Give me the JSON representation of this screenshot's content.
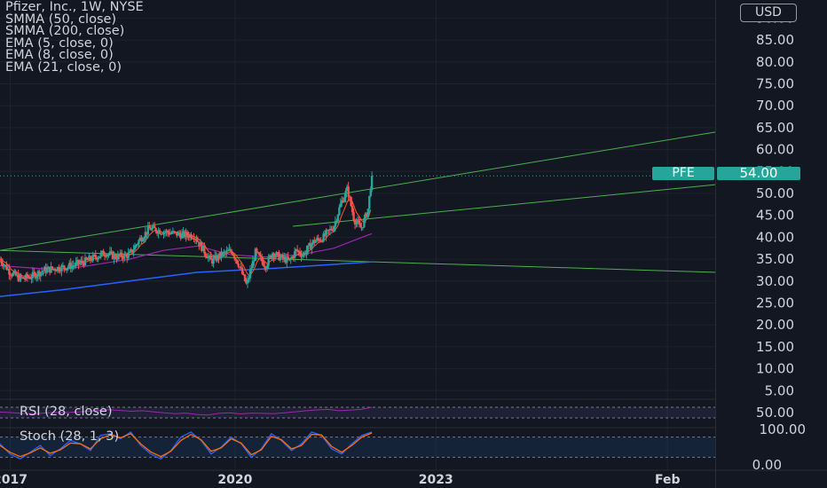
{
  "legend": {
    "title": "Pfizer, Inc., 1W, NYSE",
    "lines": [
      "SMMA (50, close)",
      "SMMA (200, close)",
      "EMA (5, close, 0)",
      "EMA (8, close, 0)",
      "EMA (21, close, 0)"
    ]
  },
  "currency": "USD",
  "last_price": {
    "ticker": "PFE",
    "value": "54.00"
  },
  "rsi_label": "RSI (28, close)",
  "stoch_label": "Stoch (28, 1, 3)",
  "rsi_axis_label": "50.00",
  "stoch_axis_labels": [
    "100.00",
    "0.00"
  ],
  "colors": {
    "background": "#131722",
    "up": "#26a69a",
    "down": "#ef5350",
    "trend": "#4caf50",
    "smma200": "#2962ff",
    "smma50": "#9c27b0",
    "ema": "#ff5722",
    "rsi": "#9c27b0",
    "stoch_k": "#2962ff",
    "stoch_d": "#ff6d00"
  },
  "chart_data": [
    {
      "type": "candlestick",
      "title": "Pfizer, Inc., 1W, NYSE",
      "ylabel": "USD",
      "yticks": [
        "5.00",
        "10.00",
        "15.00",
        "20.00",
        "25.00",
        "30.00",
        "35.00",
        "40.00",
        "45.00",
        "50.00",
        "55.00",
        "60.00",
        "65.00",
        "70.00",
        "75.00",
        "80.00",
        "85.00",
        "90.00"
      ],
      "ylim": [
        0,
        92
      ],
      "xticks": [
        "2017",
        "2020",
        "2023",
        "Feb"
      ],
      "xlim": [
        2016.6,
        2027.1
      ],
      "grid": true,
      "last_close": 54.0,
      "price_path": [
        [
          2016.6,
          35.0
        ],
        [
          2016.75,
          32.0
        ],
        [
          2016.9,
          30.5
        ],
        [
          2017.05,
          31.0
        ],
        [
          2017.25,
          32.5
        ],
        [
          2017.45,
          33.0
        ],
        [
          2017.65,
          33.5
        ],
        [
          2017.85,
          34.5
        ],
        [
          2018.0,
          35.5
        ],
        [
          2018.15,
          36.5
        ],
        [
          2018.3,
          35.5
        ],
        [
          2018.5,
          36.0
        ],
        [
          2018.65,
          39.5
        ],
        [
          2018.8,
          42.0
        ],
        [
          2018.95,
          41.5
        ],
        [
          2019.1,
          41.0
        ],
        [
          2019.3,
          40.5
        ],
        [
          2019.45,
          40.5
        ],
        [
          2019.55,
          38.0
        ],
        [
          2019.7,
          34.5
        ],
        [
          2019.85,
          36.0
        ],
        [
          2020.0,
          37.0
        ],
        [
          2020.1,
          34.0
        ],
        [
          2020.22,
          29.0
        ],
        [
          2020.35,
          36.5
        ],
        [
          2020.5,
          33.5
        ],
        [
          2020.6,
          36.5
        ],
        [
          2020.7,
          35.5
        ],
        [
          2020.85,
          34.5
        ],
        [
          2020.95,
          37.0
        ],
        [
          2021.05,
          36.0
        ],
        [
          2021.2,
          39.0
        ],
        [
          2021.35,
          40.0
        ],
        [
          2021.5,
          42.5
        ],
        [
          2021.6,
          47.5
        ],
        [
          2021.7,
          51.0
        ],
        [
          2021.8,
          44.0
        ],
        [
          2021.9,
          42.0
        ],
        [
          2022.0,
          46.0
        ],
        [
          2022.06,
          54.0
        ]
      ],
      "smma50_path": [
        [
          2016.6,
          33.5
        ],
        [
          2017.5,
          32.5
        ],
        [
          2018.5,
          35.0
        ],
        [
          2019.0,
          37.0
        ],
        [
          2019.5,
          38.0
        ],
        [
          2020.0,
          36.0
        ],
        [
          2020.5,
          35.5
        ],
        [
          2021.0,
          36.0
        ],
        [
          2021.5,
          37.5
        ],
        [
          2022.0,
          40.5
        ],
        [
          2022.06,
          40.8
        ]
      ],
      "smma200_path": [
        [
          2016.6,
          26.5
        ],
        [
          2017.5,
          28.0
        ],
        [
          2018.5,
          30.0
        ],
        [
          2019.5,
          32.0
        ],
        [
          2020.5,
          32.8
        ],
        [
          2021.5,
          33.8
        ],
        [
          2022.06,
          34.4
        ]
      ],
      "trendlines": [
        {
          "from": [
            2016.6,
            37.0
          ],
          "to": [
            2027.1,
            64.0
          ]
        },
        {
          "from": [
            2016.6,
            37.0
          ],
          "to": [
            2027.1,
            32.0
          ]
        },
        {
          "from": [
            2020.9,
            42.5
          ],
          "to": [
            2027.1,
            52.0
          ]
        }
      ]
    },
    {
      "type": "line",
      "title": "RSI (28, close)",
      "ylim": [
        0,
        100
      ],
      "yticks": [
        "50.00"
      ],
      "series": [
        {
          "values": [
            52,
            50,
            47,
            45,
            48,
            51,
            50,
            52,
            55,
            58,
            61,
            58,
            55,
            57,
            53,
            49,
            46,
            48,
            43,
            41,
            47,
            49,
            45,
            48,
            47,
            46,
            49,
            53,
            57,
            60,
            62,
            57,
            59,
            62,
            70
          ]
        }
      ]
    },
    {
      "type": "line",
      "title": "Stoch (28, 1, 3)",
      "ylim": [
        0,
        100
      ],
      "yticks": [
        "100.00",
        "0.00"
      ],
      "series": [
        {
          "values": [
            60,
            30,
            15,
            35,
            55,
            25,
            45,
            70,
            60,
            40,
            85,
            90,
            75,
            95,
            55,
            30,
            15,
            40,
            80,
            95,
            70,
            30,
            50,
            80,
            60,
            20,
            45,
            90,
            70,
            40,
            60,
            95,
            85,
            45,
            30,
            60,
            85,
            95
          ]
        },
        {
          "values": [
            55,
            35,
            22,
            33,
            48,
            32,
            42,
            62,
            60,
            45,
            75,
            87,
            78,
            90,
            60,
            36,
            22,
            38,
            70,
            88,
            72,
            38,
            48,
            75,
            62,
            28,
            42,
            82,
            72,
            45,
            55,
            88,
            86,
            52,
            35,
            55,
            80,
            92
          ]
        }
      ]
    }
  ]
}
